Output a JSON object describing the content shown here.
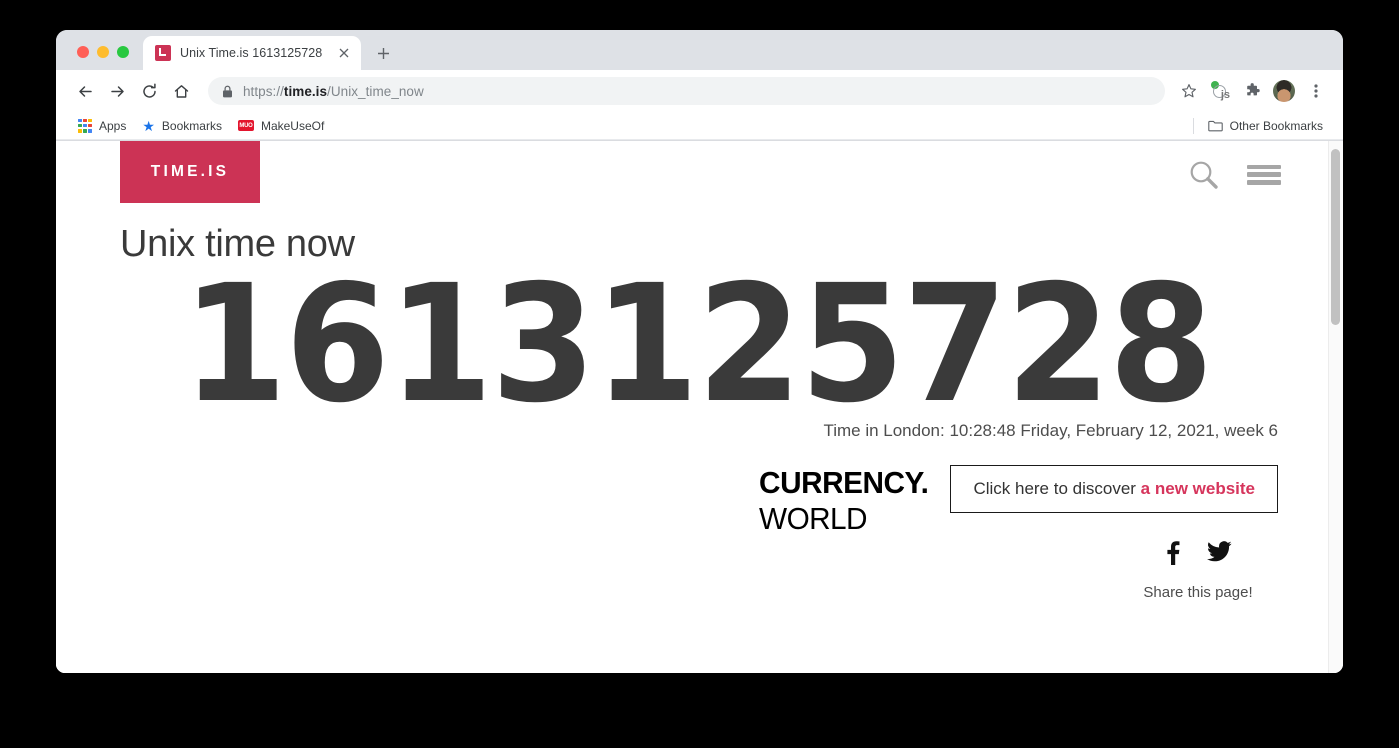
{
  "browser": {
    "traffic_lights": [
      {
        "name": "close",
        "color": "#ff5f57"
      },
      {
        "name": "minimize",
        "color": "#febc2e"
      },
      {
        "name": "maximize",
        "color": "#28c840"
      }
    ],
    "tab": {
      "title": "Unix Time.is 1613125728",
      "favicon": "timeis-favicon",
      "close_label": "×"
    },
    "new_tab_label": "+",
    "toolbar": {
      "back_label": "←",
      "forward_label": "→",
      "reload_label": "↻",
      "home_label": "⌂",
      "url_scheme": "https://",
      "url_host": "time.is",
      "url_path": "/Unix_time_now",
      "star_label": "☆",
      "extension_js_label": "js",
      "extensions_label": "puzzle-piece",
      "profile_label": "avatar",
      "menu_label": "⋮"
    },
    "bookmarks": {
      "items": [
        {
          "label": "Apps",
          "icon": "apps-grid-icon"
        },
        {
          "label": "Bookmarks",
          "icon": "star-icon"
        },
        {
          "label": "MakeUseOf",
          "icon": "makeuseof-favicon"
        }
      ],
      "other_bookmarks": {
        "label": "Other Bookmarks",
        "icon": "folder-icon"
      }
    }
  },
  "page": {
    "logo_text": "TIME.IS",
    "logo_color": "#cc3355",
    "header_icons": [
      {
        "name": "search-icon",
        "label": "Search"
      },
      {
        "name": "menu-icon",
        "label": "Menu"
      }
    ],
    "title": "Unix time now",
    "unix_timestamp": "1613125728",
    "time_line": "Time in London: 10:28:48 Friday, February 12, 2021, week 6",
    "ad": {
      "brand_heavy": "CURRENCY.",
      "brand_light": "WORLD",
      "button_text": "Click here to discover ",
      "button_accent": "a new website",
      "accent_color": "#d6355c"
    },
    "share": {
      "label": "Share this page!",
      "networks": [
        {
          "name": "facebook-icon",
          "label": "Facebook"
        },
        {
          "name": "twitter-icon",
          "label": "Twitter"
        }
      ]
    }
  }
}
